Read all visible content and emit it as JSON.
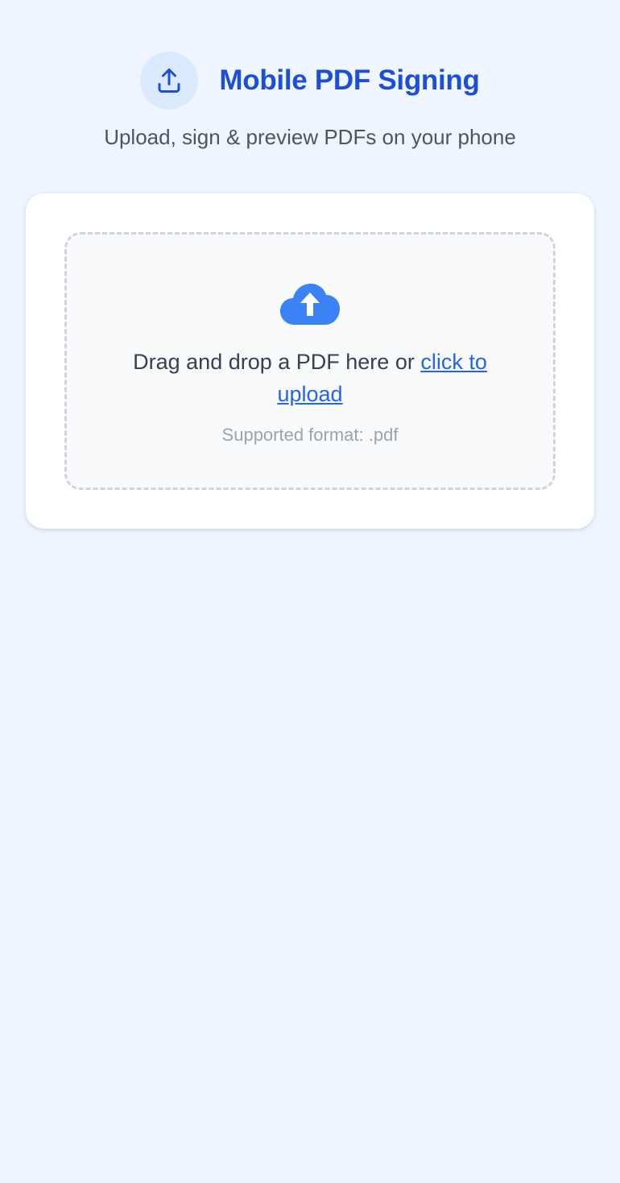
{
  "header": {
    "title": "Mobile PDF Signing",
    "subtitle": "Upload, sign & preview PDFs on your phone",
    "icon": "upload-icon"
  },
  "dropzone": {
    "icon": "cloud-upload-icon",
    "prompt_text": "Drag and drop a PDF here or ",
    "link_text": "click to upload",
    "format_note": "Supported format: .pdf"
  },
  "colors": {
    "background": "#eff6ff",
    "accent": "#1d4ed8",
    "link": "#2563eb",
    "icon_circle": "#dbeafe",
    "cloud": "#3b82f6"
  }
}
